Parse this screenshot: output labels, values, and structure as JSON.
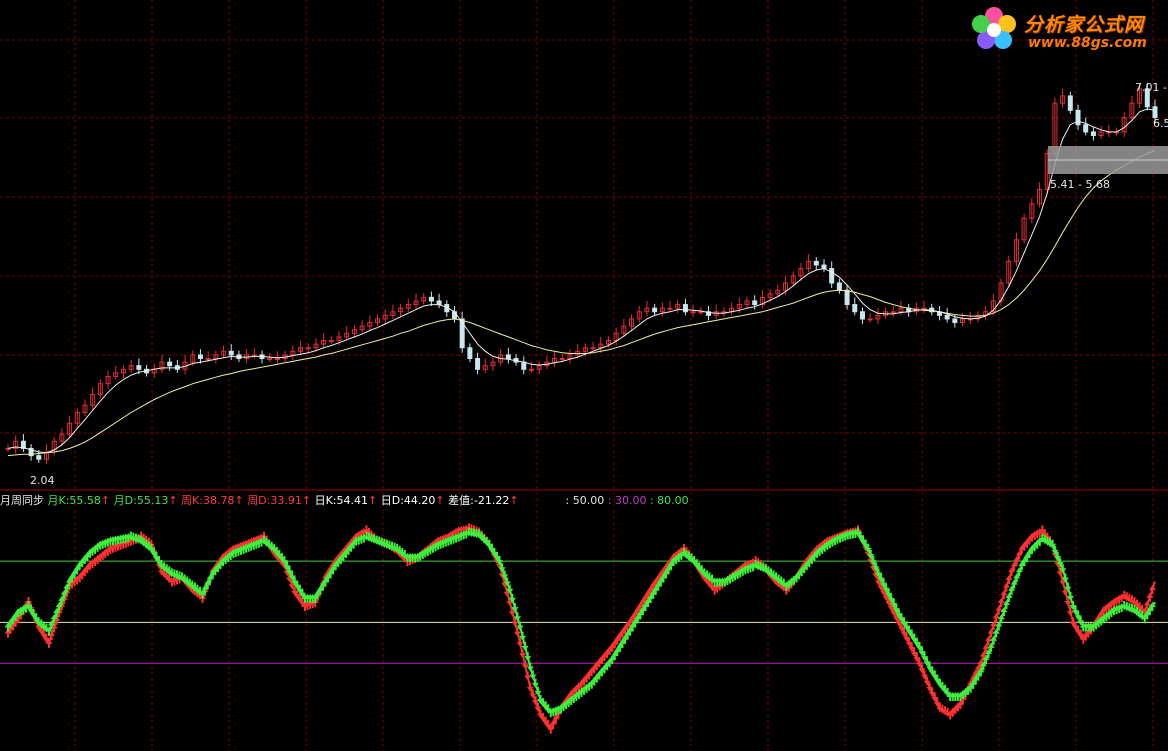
{
  "brand": {
    "title": "分析家公式网",
    "url": "www.88gs.com"
  },
  "price_labels": {
    "low": "2.04",
    "range": "5.41 - 5.68",
    "high_a": "7.01 -",
    "high_b": "6.5"
  },
  "legend": {
    "title": "月周同步",
    "yk_label": "月K:",
    "yk_value": "55.58",
    "yd_label": "月D:",
    "yd_value": "55.13",
    "zk_label": "周K:",
    "zk_value": "38.78",
    "zd_label": "周D:",
    "zd_value": "33.91",
    "rk_label": "日K:",
    "rk_value": "54.41",
    "rd_label": "日D:",
    "rd_value": "44.20",
    "diff_label": "差值:",
    "diff_value": "-21.22",
    "arrow": "↑",
    "l50": ": 50.00",
    "l30": ": 30.00",
    "l80": ": 80.00"
  },
  "colors": {
    "background": "#000000",
    "grid": "#7a0000",
    "bull_candle": "#e03030",
    "bear_candle": "#c8e8f0",
    "ma_fast": "#f0f0f0",
    "ma_slow": "#f0f0a0",
    "k_line": "#ff3030",
    "d_line": "#3cf03c",
    "level_80": "#3cd03c",
    "level_50": "#e8e8a0",
    "level_30": "#c020c0"
  },
  "chart_data": [
    {
      "type": "candlestick",
      "title": "",
      "note": "price panel, values estimated",
      "y_range": [
        1.9,
        7.6
      ],
      "x_count": 150,
      "close": [
        2.2,
        2.3,
        2.2,
        2.1,
        2.05,
        2.15,
        2.3,
        2.4,
        2.55,
        2.7,
        2.8,
        2.95,
        3.1,
        3.2,
        3.25,
        3.3,
        3.35,
        3.3,
        3.25,
        3.3,
        3.4,
        3.35,
        3.3,
        3.4,
        3.5,
        3.45,
        3.45,
        3.5,
        3.55,
        3.5,
        3.45,
        3.5,
        3.5,
        3.45,
        3.45,
        3.45,
        3.5,
        3.55,
        3.6,
        3.6,
        3.65,
        3.7,
        3.7,
        3.75,
        3.8,
        3.85,
        3.9,
        3.95,
        4.0,
        4.05,
        4.1,
        4.15,
        4.2,
        4.25,
        4.3,
        4.25,
        4.2,
        4.1,
        4.0,
        3.6,
        3.45,
        3.3,
        3.35,
        3.4,
        3.5,
        3.45,
        3.4,
        3.3,
        3.3,
        3.35,
        3.4,
        3.45,
        3.45,
        3.5,
        3.55,
        3.6,
        3.6,
        3.65,
        3.7,
        3.8,
        3.9,
        4.0,
        4.1,
        4.15,
        4.1,
        4.15,
        4.15,
        4.2,
        4.1,
        4.1,
        4.1,
        4.05,
        4.1,
        4.1,
        4.15,
        4.2,
        4.25,
        4.2,
        4.3,
        4.35,
        4.4,
        4.5,
        4.6,
        4.7,
        4.8,
        4.75,
        4.7,
        4.5,
        4.4,
        4.2,
        4.1,
        4.0,
        4.0,
        4.05,
        4.1,
        4.1,
        4.15,
        4.1,
        4.15,
        4.15,
        4.1,
        4.05,
        4.0,
        3.95,
        4.0,
        4.0,
        4.05,
        4.1,
        4.25,
        4.5,
        4.8,
        5.1,
        5.4,
        5.6,
        5.8,
        6.3,
        7.0,
        7.1,
        6.9,
        6.7,
        6.6,
        6.55,
        6.6,
        6.6,
        6.6,
        6.8,
        7.0,
        7.2,
        6.95,
        6.8
      ],
      "ma_fast": [
        2.2,
        2.22,
        2.21,
        2.18,
        2.15,
        2.14,
        2.18,
        2.25,
        2.35,
        2.48,
        2.6,
        2.73,
        2.86,
        2.98,
        3.08,
        3.16,
        3.22,
        3.26,
        3.28,
        3.3,
        3.32,
        3.32,
        3.32,
        3.34,
        3.38,
        3.4,
        3.42,
        3.44,
        3.46,
        3.48,
        3.47,
        3.47,
        3.48,
        3.48,
        3.47,
        3.46,
        3.47,
        3.49,
        3.51,
        3.53,
        3.56,
        3.6,
        3.63,
        3.67,
        3.71,
        3.75,
        3.79,
        3.84,
        3.88,
        3.93,
        3.98,
        4.03,
        4.08,
        4.13,
        4.18,
        4.2,
        4.2,
        4.16,
        4.1,
        3.95,
        3.8,
        3.65,
        3.55,
        3.48,
        3.45,
        3.44,
        3.42,
        3.4,
        3.37,
        3.36,
        3.37,
        3.39,
        3.41,
        3.44,
        3.47,
        3.51,
        3.55,
        3.59,
        3.63,
        3.69,
        3.76,
        3.84,
        3.92,
        4.0,
        4.05,
        4.08,
        4.1,
        4.13,
        4.13,
        4.12,
        4.11,
        4.09,
        4.08,
        4.08,
        4.1,
        4.12,
        4.15,
        4.17,
        4.21,
        4.26,
        4.31,
        4.38,
        4.46,
        4.55,
        4.63,
        4.68,
        4.7,
        4.65,
        4.58,
        4.47,
        4.35,
        4.22,
        4.13,
        4.08,
        4.07,
        4.07,
        4.09,
        4.1,
        4.12,
        4.13,
        4.12,
        4.1,
        4.07,
        4.03,
        4.01,
        4.0,
        4.01,
        4.04,
        4.12,
        4.26,
        4.45,
        4.67,
        4.92,
        5.17,
        5.42,
        5.75,
        6.15,
        6.5,
        6.7,
        6.75,
        6.72,
        6.67,
        6.63,
        6.6,
        6.6,
        6.66,
        6.76,
        6.88,
        6.92,
        6.9
      ],
      "ma_slow": [
        2.1,
        2.11,
        2.12,
        2.12,
        2.13,
        2.14,
        2.15,
        2.17,
        2.2,
        2.24,
        2.29,
        2.35,
        2.42,
        2.49,
        2.56,
        2.63,
        2.7,
        2.76,
        2.82,
        2.88,
        2.93,
        2.98,
        3.02,
        3.06,
        3.1,
        3.13,
        3.16,
        3.19,
        3.22,
        3.24,
        3.27,
        3.29,
        3.31,
        3.33,
        3.35,
        3.37,
        3.39,
        3.41,
        3.43,
        3.45,
        3.47,
        3.5,
        3.52,
        3.55,
        3.58,
        3.61,
        3.64,
        3.67,
        3.7,
        3.73,
        3.76,
        3.8,
        3.83,
        3.87,
        3.91,
        3.94,
        3.97,
        3.99,
        4.0,
        3.98,
        3.95,
        3.91,
        3.87,
        3.83,
        3.79,
        3.75,
        3.71,
        3.67,
        3.63,
        3.6,
        3.57,
        3.55,
        3.53,
        3.52,
        3.52,
        3.52,
        3.53,
        3.55,
        3.57,
        3.6,
        3.63,
        3.67,
        3.71,
        3.75,
        3.79,
        3.82,
        3.85,
        3.88,
        3.9,
        3.92,
        3.94,
        3.96,
        3.98,
        4.0,
        4.02,
        4.04,
        4.06,
        4.08,
        4.1,
        4.13,
        4.16,
        4.19,
        4.22,
        4.26,
        4.3,
        4.34,
        4.37,
        4.39,
        4.4,
        4.39,
        4.37,
        4.34,
        4.31,
        4.27,
        4.23,
        4.2,
        4.17,
        4.15,
        4.13,
        4.12,
        4.11,
        4.1,
        4.08,
        4.06,
        4.05,
        4.04,
        4.04,
        4.05,
        4.08,
        4.13,
        4.2,
        4.29,
        4.4,
        4.53,
        4.67,
        4.83,
        5.01,
        5.2,
        5.38,
        5.55,
        5.7,
        5.82,
        5.92,
        6.0,
        6.07,
        6.13,
        6.19,
        6.25,
        6.3,
        6.34
      ]
    },
    {
      "type": "line",
      "title": "月周同步",
      "note": "oscillator panel, values estimated",
      "ylim": [
        -10,
        105
      ],
      "levels": [
        80,
        50,
        30
      ],
      "series": [
        {
          "name": "K",
          "color": "#ff3030",
          "values": [
            45,
            52,
            60,
            48,
            40,
            55,
            68,
            72,
            78,
            82,
            86,
            88,
            90,
            92,
            88,
            75,
            70,
            72,
            66,
            62,
            75,
            82,
            86,
            88,
            90,
            92,
            84,
            78,
            65,
            58,
            60,
            72,
            80,
            86,
            92,
            95,
            90,
            88,
            85,
            80,
            82,
            86,
            90,
            92,
            95,
            96,
            94,
            88,
            78,
            60,
            40,
            18,
            5,
            -2,
            8,
            15,
            20,
            26,
            32,
            38,
            45,
            52,
            60,
            68,
            75,
            82,
            86,
            80,
            72,
            66,
            70,
            74,
            78,
            80,
            76,
            70,
            66,
            72,
            80,
            86,
            90,
            92,
            94,
            95,
            84,
            70,
            60,
            50,
            40,
            30,
            18,
            8,
            5,
            10,
            20,
            30,
            45,
            60,
            75,
            86,
            92,
            95,
            88,
            70,
            50,
            42,
            48,
            56,
            60,
            63,
            60,
            55,
            70
          ]
        },
        {
          "name": "D",
          "color": "#3cf03c",
          "values": [
            48,
            55,
            58,
            50,
            46,
            58,
            70,
            78,
            84,
            88,
            90,
            91,
            92,
            90,
            86,
            78,
            74,
            72,
            68,
            64,
            74,
            80,
            84,
            86,
            88,
            90,
            86,
            80,
            70,
            62,
            62,
            70,
            78,
            84,
            90,
            92,
            90,
            88,
            86,
            82,
            82,
            85,
            88,
            90,
            92,
            94,
            93,
            88,
            80,
            66,
            48,
            28,
            12,
            6,
            8,
            12,
            16,
            20,
            26,
            32,
            40,
            48,
            56,
            64,
            72,
            80,
            84,
            80,
            74,
            70,
            70,
            73,
            76,
            78,
            76,
            72,
            68,
            72,
            78,
            84,
            88,
            91,
            93,
            94,
            86,
            74,
            64,
            54,
            46,
            38,
            28,
            20,
            14,
            14,
            18,
            26,
            38,
            52,
            66,
            78,
            86,
            91,
            88,
            76,
            58,
            48,
            48,
            52,
            56,
            58,
            56,
            52,
            60
          ]
        }
      ]
    }
  ]
}
